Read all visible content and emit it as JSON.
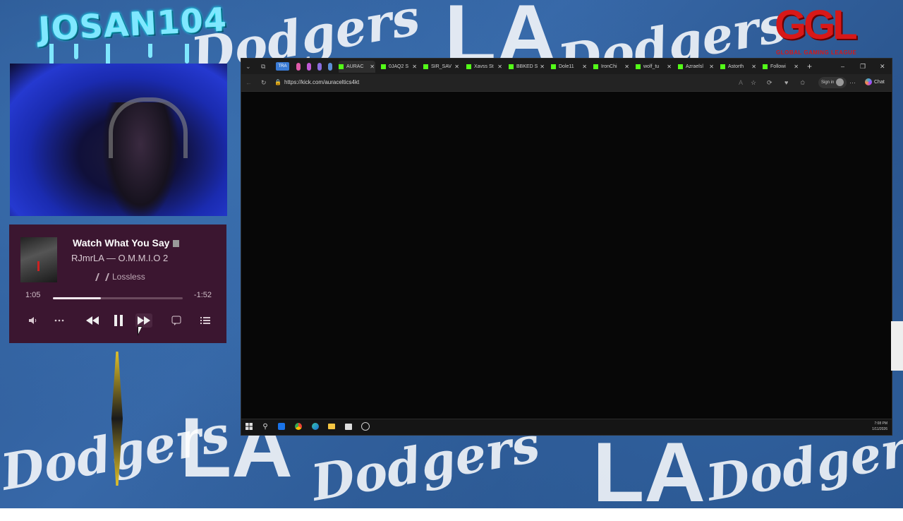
{
  "overlay": {
    "streamer_name": "JOSAN104",
    "brand_logo": "GGL",
    "brand_tagline": "GLOBAL GAMING LEAGUE",
    "background_words": {
      "team": "Dodgers",
      "city": "LA"
    },
    "colors": {
      "background": "#2f5f9c",
      "brand_red": "#d81818",
      "kick_green": "#53fc18",
      "player_bg": "#3b1630"
    }
  },
  "music_player": {
    "title": "Watch What You Say",
    "artist_album": "RJmrLA — O.M.M.I.O 2",
    "quality": "Lossless",
    "current_time": "1:05",
    "remaining_time": "-1:52",
    "progress": 0.37,
    "controls": [
      "volume-icon",
      "more-icon",
      "rewind-icon",
      "pause-icon",
      "fast-forward-icon",
      "lyrics-icon",
      "queue-icon"
    ]
  },
  "browser": {
    "tra_badge": "TRA",
    "tabs": [
      {
        "label": "AURAC"
      },
      {
        "label": "0JAQ2 S"
      },
      {
        "label": "SIR_SAV"
      },
      {
        "label": "Xavss St"
      },
      {
        "label": "BBKED S"
      },
      {
        "label": "Dole11 "
      },
      {
        "label": "IronChi"
      },
      {
        "label": "wolf_tu"
      },
      {
        "label": "Azraelsl"
      },
      {
        "label": "Astorth"
      },
      {
        "label": "Followi"
      }
    ],
    "url": "https://kick.com/auraceltics4kt",
    "sign_in": "Sign in",
    "chat": "Chat",
    "new_tab": "+"
  },
  "taskbar": {
    "time": "7:08 PM",
    "date": "1/11/2026",
    "icons": [
      "windows-start-icon",
      "search-icon",
      "outlook-icon",
      "chrome-icon",
      "edge-icon",
      "file-explorer-icon",
      "store-icon",
      "discord-icon"
    ]
  }
}
